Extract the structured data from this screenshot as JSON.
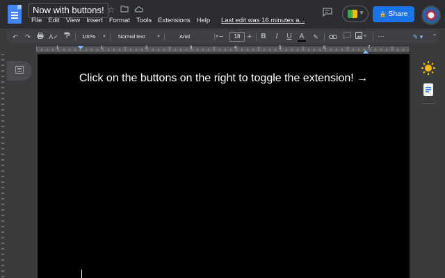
{
  "header": {
    "title": "Now with buttons!",
    "menu": [
      "File",
      "Edit",
      "View",
      "Insert",
      "Format",
      "Tools",
      "Extensions",
      "Help"
    ],
    "last_edit": "Last edit was 16 minutes a...",
    "share_label": "Share"
  },
  "toolbar": {
    "zoom": "100%",
    "style": "Normal text",
    "font": "Arial",
    "font_size": "18",
    "minus": "−",
    "plus": "+",
    "bold": "B",
    "italic": "I",
    "underline": "U",
    "text_color": "A",
    "more": "···"
  },
  "ruler": {
    "numbers": [
      "1",
      "1",
      "2",
      "3",
      "4",
      "5",
      "6",
      "7"
    ]
  },
  "document": {
    "body_text": "Click on the buttons on the right to toggle the extension! →"
  },
  "colors": {
    "share": "#1a73e8",
    "page": "#000000",
    "chrome": "#2b2c2f"
  },
  "icons": [
    "docs-icon",
    "star-icon",
    "move-folder-icon",
    "cloud-icon",
    "comment-icon",
    "meet-icon",
    "lock-icon",
    "avatar",
    "undo-icon",
    "redo-icon",
    "print-icon",
    "spellcheck-icon",
    "paint-format-icon",
    "highlighter-icon",
    "link-icon",
    "add-comment-icon",
    "image-icon",
    "edit-mode-icon",
    "outline-icon",
    "sun-icon",
    "keep-notes-icon"
  ]
}
